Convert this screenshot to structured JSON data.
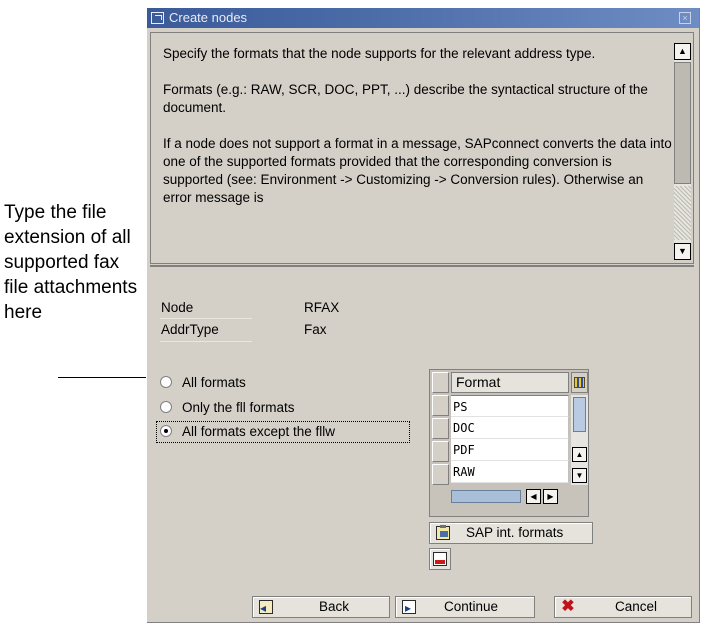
{
  "callout": {
    "text": "Type the file extension of all supported fax file attachments here"
  },
  "window": {
    "title": "Create nodes"
  },
  "help": {
    "paragraphs": [
      "Specify the formats that the node supports for the relevant address type.",
      "Formats (e.g.: RAW, SCR, DOC, PPT, ...) describe the syntactical structure of the document.",
      "If a node does not support a format in a message, SAPconnect converts the data into one of the supported formats provided that the corresponding conversion is supported (see: Environment -> Customizing -> Conversion rules). Otherwise an error message is"
    ]
  },
  "fields": {
    "node_label": "Node",
    "node_value": "RFAX",
    "addrtype_label": "AddrType",
    "addrtype_value": "Fax"
  },
  "formats_option": {
    "options": [
      "All formats",
      "Only the fll formats",
      "All formats except the fllw"
    ],
    "selected": "All formats except the fllw"
  },
  "format_table": {
    "column_header": "Format",
    "rows": [
      "PS",
      "DOC",
      "PDF",
      "RAW"
    ]
  },
  "buttons": {
    "sap_int_formats": "SAP int. formats",
    "back": "Back",
    "continue": "Continue",
    "cancel": "Cancel"
  },
  "icons": {
    "title": "dialog-window-icon",
    "close": "close-icon",
    "table_config": "column-settings-icon",
    "sap_formats": "clipboard-icon",
    "delete_row": "delete-row-icon",
    "back": "back-icon",
    "continue": "continue-icon",
    "cancel": "cancel-x-icon"
  }
}
